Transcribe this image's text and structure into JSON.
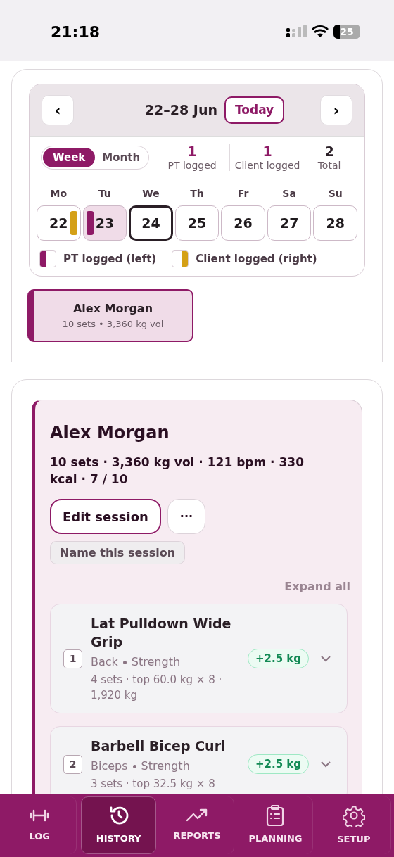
{
  "status_bar": {
    "time": "21:18",
    "battery": "25"
  },
  "calendar": {
    "prev": "‹",
    "next": "›",
    "range": "22–28 Jun",
    "today_button": "Today",
    "view_toggle": [
      {
        "label": "Week",
        "selected": true
      },
      {
        "label": "Month",
        "selected": false
      }
    ],
    "stats": [
      {
        "value": "1",
        "label": "PT logged",
        "kind": "accent"
      },
      {
        "value": "1",
        "label": "Client logged",
        "kind": "accent"
      },
      {
        "value": "2",
        "label": "Total",
        "kind": "plain"
      }
    ],
    "days": [
      {
        "weekday": "Mo",
        "date": "22",
        "pt_logged": false,
        "client_logged": true,
        "selected": false,
        "today": false
      },
      {
        "weekday": "Tu",
        "date": "23",
        "pt_logged": true,
        "client_logged": false,
        "selected": true,
        "today": false
      },
      {
        "weekday": "We",
        "date": "24",
        "pt_logged": false,
        "client_logged": false,
        "selected": false,
        "today": true
      },
      {
        "weekday": "Th",
        "date": "25",
        "pt_logged": false,
        "client_logged": false,
        "selected": false,
        "today": false
      },
      {
        "weekday": "Fr",
        "date": "26",
        "pt_logged": false,
        "client_logged": false,
        "selected": false,
        "today": false
      },
      {
        "weekday": "Sa",
        "date": "27",
        "pt_logged": false,
        "client_logged": false,
        "selected": false,
        "today": false
      },
      {
        "weekday": "Su",
        "date": "28",
        "pt_logged": false,
        "client_logged": false,
        "selected": false,
        "today": false
      }
    ],
    "legend": [
      {
        "label": "PT logged (left)",
        "kind": "pt"
      },
      {
        "label": "Client logged (right)",
        "kind": "client"
      }
    ]
  },
  "sessions": [
    {
      "name": "Alex Morgan",
      "summary": "10 sets • 3,360 kg vol",
      "selected": true
    }
  ],
  "session_detail": {
    "name": "Alex Morgan",
    "stats": "10 sets · 3,360 kg vol · 121 bpm · 330 kcal · 7 / 10",
    "edit_button": "Edit session",
    "more_button": "···",
    "name_button": "Name this session",
    "expand_all": "Expand all",
    "exercises": [
      {
        "number": "1",
        "name": "Lat Pulldown Wide Grip",
        "muscle": "Back",
        "type": "Strength",
        "detail": "4 sets · top 60.0 kg × 8 · 1,920 kg",
        "change": "+2.5 kg"
      },
      {
        "number": "2",
        "name": "Barbell Bicep Curl",
        "muscle": "Biceps",
        "type": "Strength",
        "detail": "3 sets · top 32.5 kg × 8",
        "change": "+2.5 kg"
      }
    ]
  },
  "nav": [
    {
      "label": "LOG",
      "selected": false
    },
    {
      "label": "HISTORY",
      "selected": true
    },
    {
      "label": "REPORTS",
      "selected": false
    },
    {
      "label": "PLANNING",
      "selected": false
    },
    {
      "label": "SETUP",
      "selected": false
    }
  ]
}
